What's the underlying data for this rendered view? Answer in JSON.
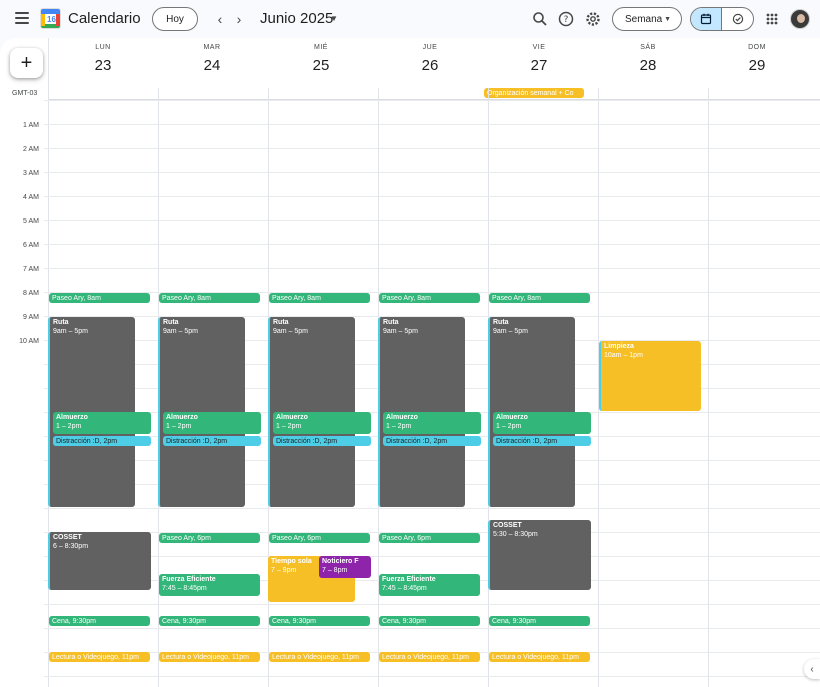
{
  "header": {
    "app_title": "Calendario",
    "logo_day": "16",
    "today_label": "Hoy",
    "month_label": "Junio 2025",
    "view_label": "Semana",
    "icons": [
      "menu-icon",
      "search-icon",
      "help-icon",
      "settings-icon",
      "calendar-icon",
      "tasks-icon",
      "apps-icon"
    ]
  },
  "timezone": "GMT-03",
  "days": [
    {
      "name": "LUN",
      "date": "23"
    },
    {
      "name": "MAR",
      "date": "24"
    },
    {
      "name": "MIÉ",
      "date": "25"
    },
    {
      "name": "JUE",
      "date": "26"
    },
    {
      "name": "VIE",
      "date": "27"
    },
    {
      "name": "SÁB",
      "date": "28"
    },
    {
      "name": "DOM",
      "date": "29"
    }
  ],
  "hours": [
    "1 AM",
    "2 AM",
    "3 AM",
    "4 AM",
    "5 AM",
    "6 AM",
    "7 AM",
    "8 AM",
    "9 AM",
    "10 AM"
  ],
  "allday": {
    "title": "Organización semanal + Co"
  },
  "events": {
    "paseo_am": "Paseo Ary, 8am",
    "ruta_title": "Ruta",
    "ruta_time": "9am – 5pm",
    "almuerzo_title": "Almuerzo",
    "almuerzo_time": "1 – 2pm",
    "distraccion": "Distracción :D, 2pm",
    "limpieza_title": "Limpieza",
    "limpieza_time": "10am – 1pm",
    "cosset_title": "COSSET",
    "cosset_mon_time": "6 – 8:30pm",
    "cosset_fri_time": "5:30 – 8:30pm",
    "paseo_pm": "Paseo Ary, 6pm",
    "fuerza_title": "Fuerza Eficiente",
    "fuerza_time": "7:45 – 8:45pm",
    "tiempo_title": "Tiempo sola",
    "tiempo_time": "7 – 9pm",
    "noticiero_title": "Noticiero F",
    "noticiero_time": "7 – 8pm",
    "cena": "Cena, 9:30pm",
    "lectura": "Lectura o Videojuego, 11pm"
  },
  "colors": {
    "green": "#33b679",
    "graphite": "#616161",
    "banana": "#f6bf26",
    "cyan": "#4ecde6",
    "grape": "#8e24aa",
    "active_toggle": "#c2e7ff"
  }
}
